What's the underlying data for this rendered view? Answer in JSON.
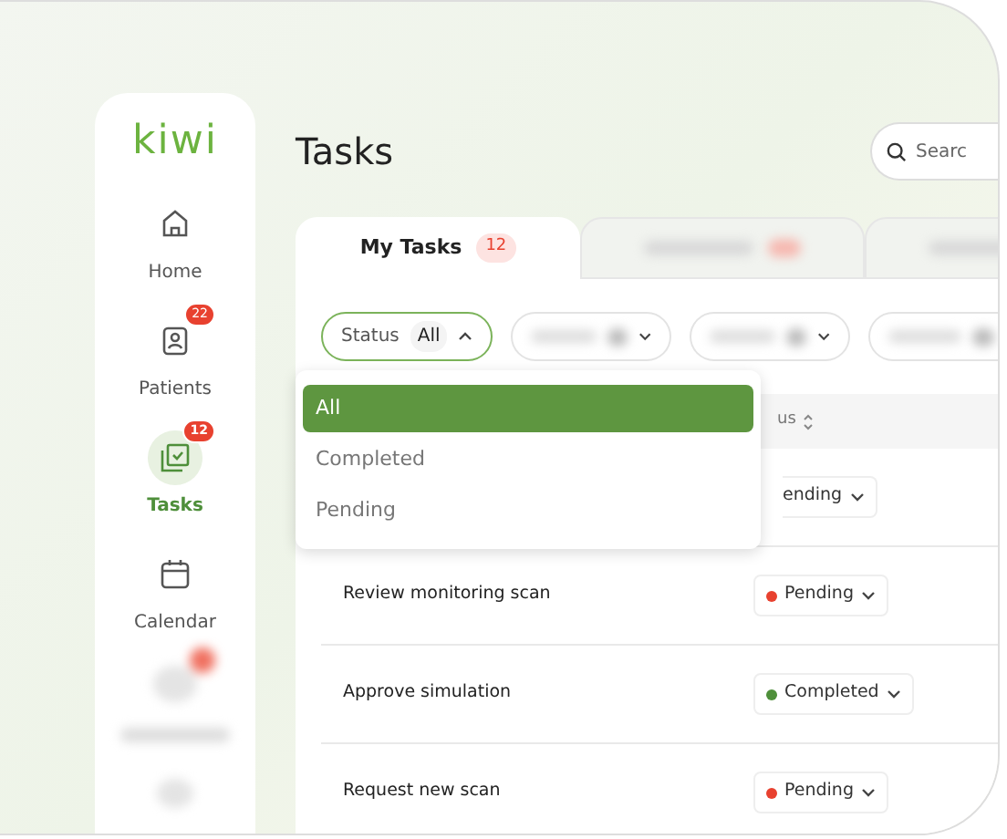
{
  "sidebar": {
    "logo": "kiwi",
    "items": [
      {
        "label": "Home",
        "selected": false
      },
      {
        "label": "Patients",
        "badge": "22",
        "selected": false
      },
      {
        "label": "Tasks",
        "badge": "12",
        "selected": true
      },
      {
        "label": "Calendar",
        "selected": false
      },
      {
        "kind": "blurred"
      }
    ]
  },
  "page": {
    "title": "Tasks",
    "search": {
      "placeholder": "Searc"
    }
  },
  "tabs": [
    {
      "label": "My Tasks",
      "count": "12",
      "selected": true
    },
    {
      "kind": "blurred",
      "selected": false
    },
    {
      "kind": "blurred",
      "selected": false
    }
  ],
  "filters": [
    {
      "label": "Status",
      "value": "All",
      "expanded": true
    },
    {
      "kind": "blurred",
      "expanded": false
    },
    {
      "kind": "blurred",
      "expanded": false
    },
    {
      "kind": "blurred",
      "expanded": false
    }
  ],
  "dropdown": {
    "options": [
      {
        "label": "All",
        "selected": true
      },
      {
        "label": "Completed",
        "selected": false
      },
      {
        "label": "Pending",
        "selected": false
      }
    ]
  },
  "table": {
    "columns": [
      "us"
    ],
    "rows": [
      {
        "status": "ending"
      },
      {
        "task": "Review monitoring scan",
        "status": "Pending",
        "color": "#e8412f"
      },
      {
        "task": "Approve simulation",
        "status": "Completed",
        "color": "#4e8f3a"
      },
      {
        "task": "Request new scan",
        "status": "Pending",
        "color": "#e8412f"
      }
    ]
  }
}
